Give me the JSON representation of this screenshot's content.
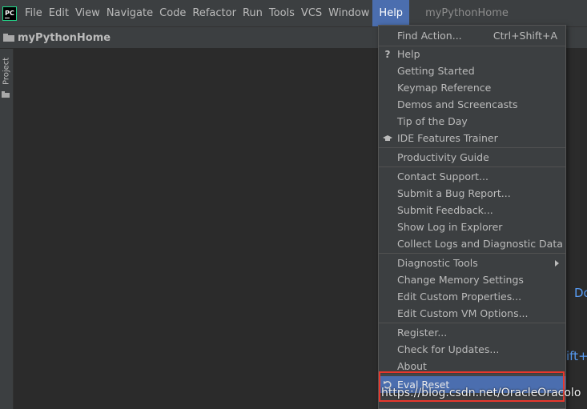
{
  "app": {
    "logo_text": "PC",
    "window_title": "myPythonHome"
  },
  "menubar": {
    "items": [
      "File",
      "Edit",
      "View",
      "Navigate",
      "Code",
      "Refactor",
      "Run",
      "Tools",
      "VCS",
      "Window",
      "Help"
    ],
    "active": "Help"
  },
  "navbar": {
    "project_name": "myPythonHome"
  },
  "left_strip": {
    "tool_window_label": "Project"
  },
  "editor": {
    "fragment_right_1": "Do",
    "fragment_right_2": "ift+"
  },
  "help_menu": {
    "items": [
      {
        "label": "Find Action...",
        "shortcut": "Ctrl+Shift+A"
      },
      {
        "label": "Help",
        "icon": "question-icon"
      },
      {
        "label": "Getting Started"
      },
      {
        "label": "Keymap Reference"
      },
      {
        "label": "Demos and Screencasts"
      },
      {
        "label": "Tip of the Day"
      },
      {
        "label": "IDE Features Trainer",
        "icon": "graduation-cap-icon"
      },
      {
        "label": "Productivity Guide"
      },
      {
        "label": "Contact Support..."
      },
      {
        "label": "Submit a Bug Report..."
      },
      {
        "label": "Submit Feedback..."
      },
      {
        "label": "Show Log in Explorer"
      },
      {
        "label": "Collect Logs and Diagnostic Data"
      },
      {
        "label": "Diagnostic Tools",
        "submenu": true
      },
      {
        "label": "Change Memory Settings"
      },
      {
        "label": "Edit Custom Properties..."
      },
      {
        "label": "Edit Custom VM Options..."
      },
      {
        "label": "Register..."
      },
      {
        "label": "Check for Updates..."
      },
      {
        "label": "About"
      },
      {
        "label": "Eval Reset",
        "icon": "reset-icon",
        "highlighted": true
      }
    ]
  },
  "watermark": {
    "text": "https://blog.csdn.net/OracleOracolo"
  },
  "colors": {
    "menubar_bg": "#3c3f41",
    "editor_bg": "#2b2b2b",
    "accent": "#4b6eaf",
    "highlight_border": "#e8372c",
    "link_blue": "#589df6"
  }
}
